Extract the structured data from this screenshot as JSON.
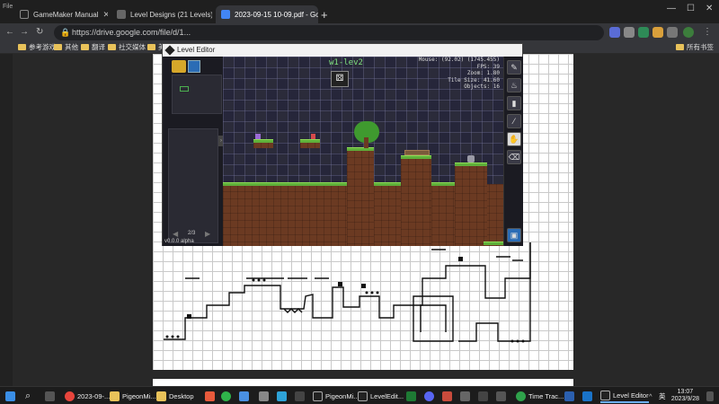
{
  "browser": {
    "window_title": "GameMaker Manual",
    "tabs": [
      {
        "label": "GameMaker Manual",
        "active": false
      },
      {
        "label": "Level Designs (21 Levels)",
        "active": false
      },
      {
        "label": "2023-09-15 10-09.pdf - Goog",
        "active": true
      }
    ],
    "url": "https://drive.google.com/file/d/1...",
    "left_strip_label": "File",
    "bookmarks": [
      "参考游戏",
      "其他",
      "翻译",
      "社交媒体",
      "美"
    ],
    "bookmarks_right": "所有书签"
  },
  "editor": {
    "title": "Level Editor",
    "level_name": "w1-lev2",
    "page_indicator": "2/3",
    "version": "v0.0.0 alpha",
    "hud": {
      "mouse": "Mouse: (92.02) (1745.455)",
      "fps": "FPS: 39",
      "zoom": "Zoom: 1.80",
      "tile_size": "Tile Size: 41.60",
      "objects": "Objects: 16"
    },
    "tools": [
      "pencil",
      "flame",
      "brush",
      "wand",
      "hand",
      "eraser"
    ],
    "selected_tool": "hand"
  },
  "taskbar": {
    "items": [
      {
        "label": "2023-09-...",
        "active": false
      },
      {
        "label": "PigeonMi...",
        "active": false
      },
      {
        "label": "Desktop",
        "active": false
      },
      {
        "label": "PigeonMi...",
        "active": false
      },
      {
        "label": "LevelEdit...",
        "active": false
      },
      {
        "label": "Time Trac...",
        "active": false
      },
      {
        "label": "Level Editor",
        "active": true
      }
    ],
    "ime": "英",
    "time": "13:07",
    "date": "2023/9/28"
  }
}
